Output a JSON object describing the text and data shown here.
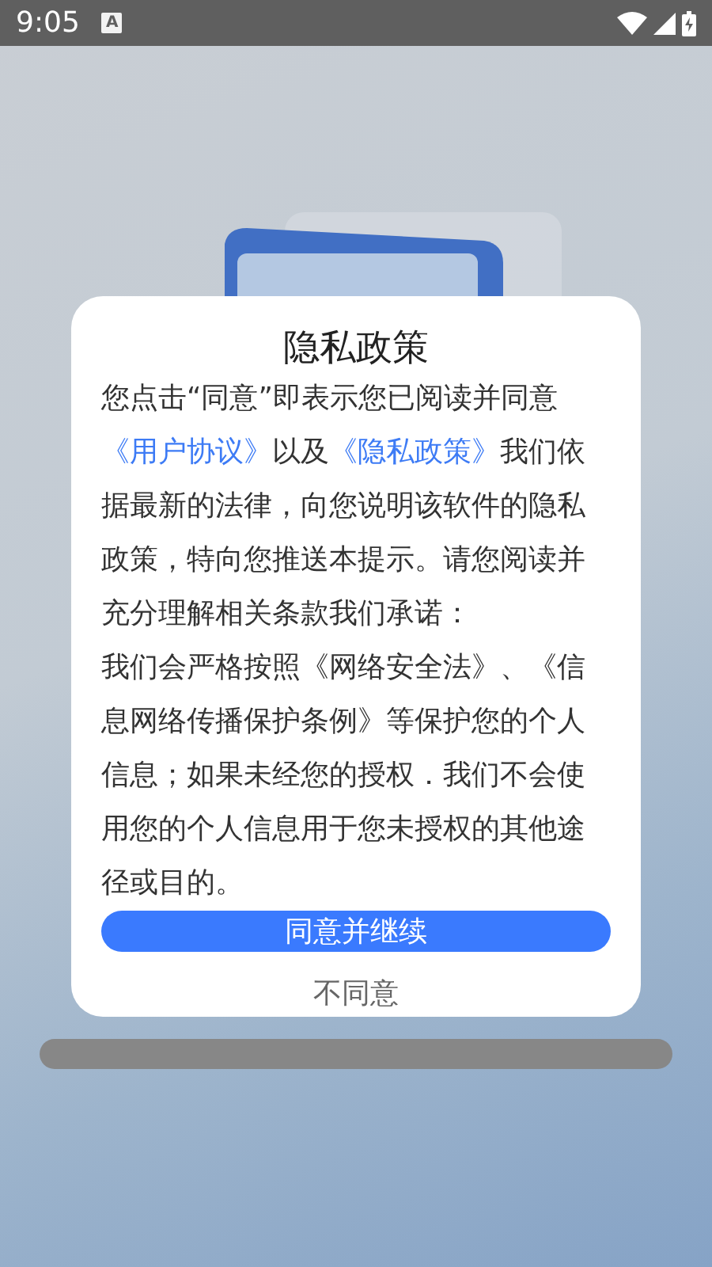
{
  "status_bar": {
    "time": "9:05",
    "notification_glyph": "A"
  },
  "dialog": {
    "title": "隐私政策",
    "paragraphs": [
      [
        {
          "kind": "text",
          "text": "您点击“同意”即表示您已阅读并同意"
        },
        {
          "kind": "link",
          "text": "《用户协议》"
        },
        {
          "kind": "text",
          "text": "以及"
        },
        {
          "kind": "link",
          "text": "《隐私政策》"
        },
        {
          "kind": "text",
          "text": "我们依据最新的法律，向您说明该软件的隐私政策，特向您推送本提示。请您阅读并充分理解相关条款我们承诺："
        }
      ],
      [
        {
          "kind": "text",
          "text": "我们会严格按照《网络安全法》、《信息网络传播保护条例》等保护您的个人信息；如果未经您的授权．我们不会使用您的个人信息用于您未授权的其他途径或目的。"
        }
      ]
    ],
    "primary_button": "同意并继续",
    "secondary_button": "不同意"
  }
}
